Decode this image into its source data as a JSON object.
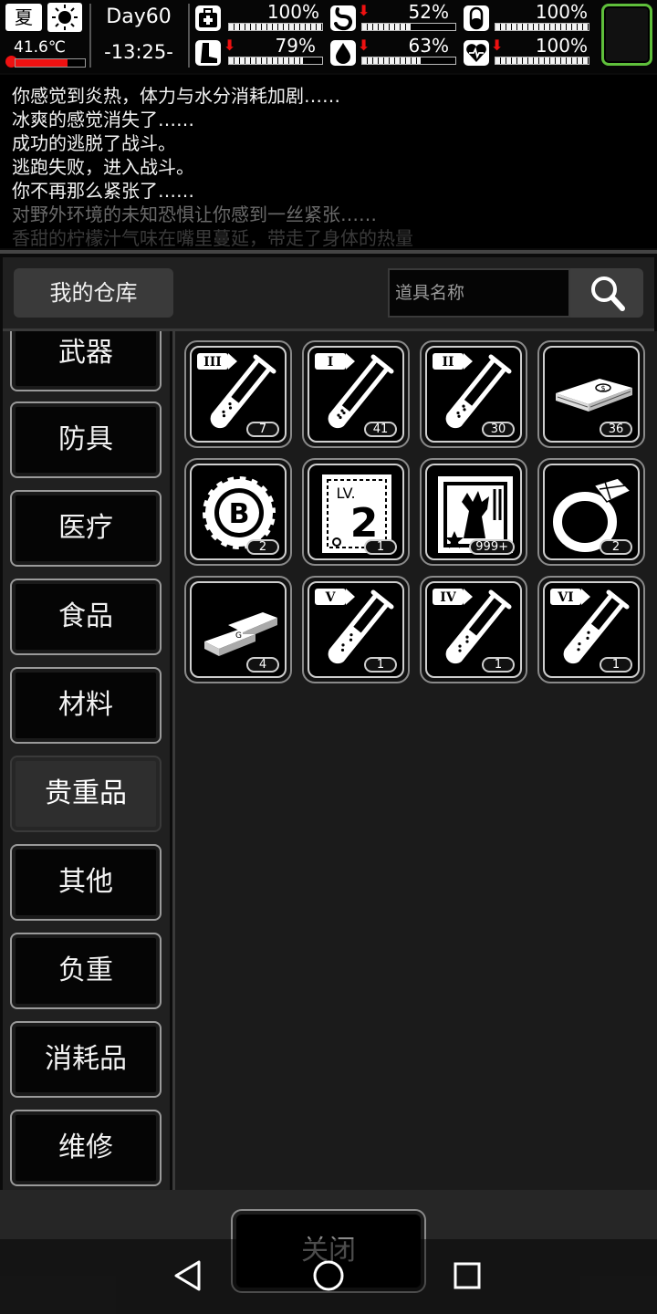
{
  "status": {
    "season": "夏",
    "temperature": "41.6℃",
    "temp_level": 0.75,
    "day": "Day60",
    "time": "-13:25-",
    "stats": [
      {
        "icon": "health-icon",
        "percent": "100%",
        "level": 1.0
      },
      {
        "icon": "stomach-icon",
        "percent": "52%",
        "level": 0.52
      },
      {
        "icon": "pill-icon",
        "percent": "100%",
        "level": 1.0
      },
      {
        "icon": "stamina-leg-icon",
        "percent": "79%",
        "level": 0.79
      },
      {
        "icon": "water-drop-icon",
        "percent": "63%",
        "level": 0.63
      },
      {
        "icon": "heart-icon",
        "percent": "100%",
        "level": 1.0
      }
    ]
  },
  "log": [
    "你感觉到炎热，体力与水分消耗加剧……",
    "冰爽的感觉消失了……",
    "成功的逃脱了战斗。",
    "逃跑失败，进入战斗。",
    "你不再那么紧张了……",
    "对野外环境的未知恐惧让你感到一丝紧张……",
    "香甜的柠檬汁气味在嘴里蔓延，带走了身体的热量"
  ],
  "header": {
    "title": "我的仓库",
    "search_placeholder": "道具名称"
  },
  "categories": [
    "武器",
    "防具",
    "医疗",
    "食品",
    "材料",
    "贵重品",
    "其他",
    "负重",
    "消耗品",
    "维修"
  ],
  "active_category": "贵重品",
  "items": [
    {
      "icon": "test-tube-icon",
      "label": "III",
      "count": "7",
      "fill": 0.35
    },
    {
      "icon": "test-tube-icon",
      "label": "I",
      "count": "41",
      "fill": 0.2
    },
    {
      "icon": "test-tube-icon",
      "label": "II",
      "count": "30",
      "fill": 0.3
    },
    {
      "icon": "cash-stack-icon",
      "count": "36"
    },
    {
      "icon": "bitcoin-chip-icon",
      "label": "B",
      "count": "2"
    },
    {
      "icon": "level-ticket-icon",
      "label": "LV.",
      "value": "2",
      "count": "1"
    },
    {
      "icon": "monster-card-icon",
      "count": "999+"
    },
    {
      "icon": "ring-icon",
      "count": "2"
    },
    {
      "icon": "gold-bars-icon",
      "count": "4"
    },
    {
      "icon": "test-tube-icon",
      "label": "V",
      "count": "1",
      "fill": 0.45
    },
    {
      "icon": "test-tube-icon",
      "label": "IV",
      "count": "1",
      "fill": 0.4
    },
    {
      "icon": "test-tube-icon",
      "label": "VI",
      "count": "1",
      "fill": 0.5
    }
  ],
  "close_label": "关闭",
  "colors": {
    "accent_green": "#5fbf3b",
    "warning_red": "#e11"
  }
}
